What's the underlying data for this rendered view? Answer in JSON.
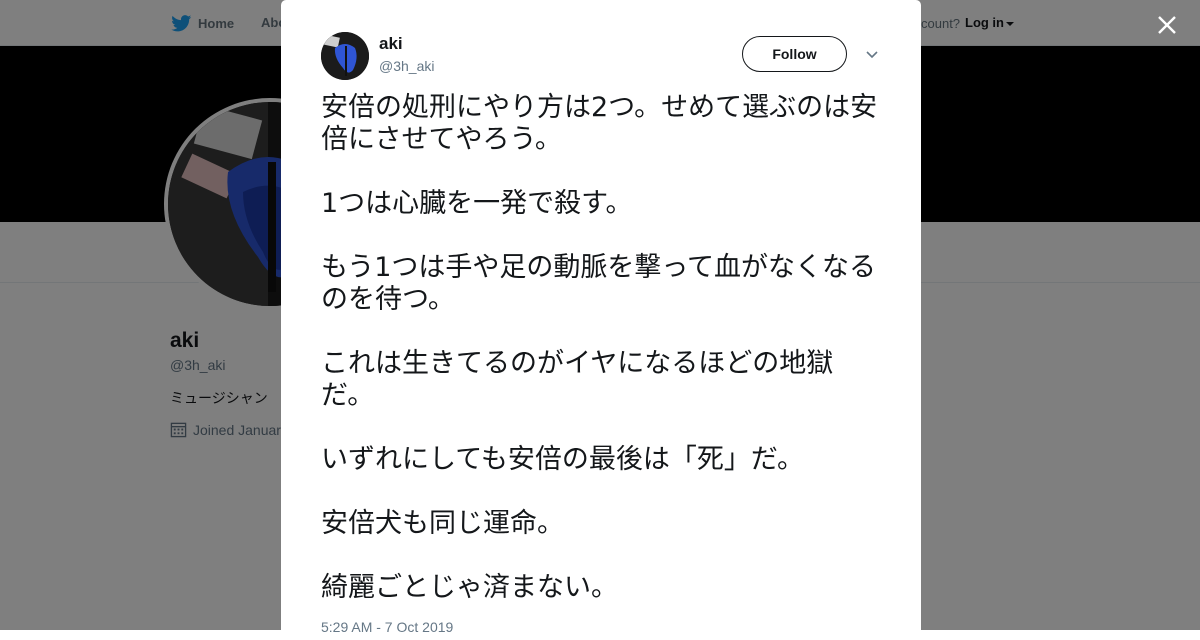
{
  "nav": {
    "home_label": "Home",
    "about_label": "Abo",
    "account_text": "count?",
    "login_label": "Log in"
  },
  "profile": {
    "name": "aki",
    "handle": "@3h_aki",
    "bio": "ミュージシャン",
    "joined": "Joined Januar"
  },
  "tweet": {
    "name": "aki",
    "handle": "@3h_aki",
    "follow_label": "Follow",
    "paragraphs": [
      "安倍の処刑にやり方は2つ。せめて選ぶのは安倍にさせてやろう。",
      "1つは心臓を一発で殺す。",
      "もう1つは手や足の動脈を撃って血がなくなるのを待つ。",
      "これは生きてるのがイヤになるほどの地獄だ。",
      "いずれにしても安倍の最後は「死」だ。",
      "安倍犬も同じ運命。",
      "綺麗ごとじゃ済まない。"
    ],
    "timestamp": "5:29 AM - 7 Oct 2019"
  },
  "colors": {
    "brand_blue": "#1da1f2",
    "text_primary": "#14171a",
    "text_secondary": "#657786",
    "overlay": "rgba(0,0,0,0.5)"
  },
  "icons": {
    "nav_logo": "bird-icon",
    "close": "close-icon",
    "more": "chevron-down-icon",
    "joined": "calendar-icon"
  }
}
